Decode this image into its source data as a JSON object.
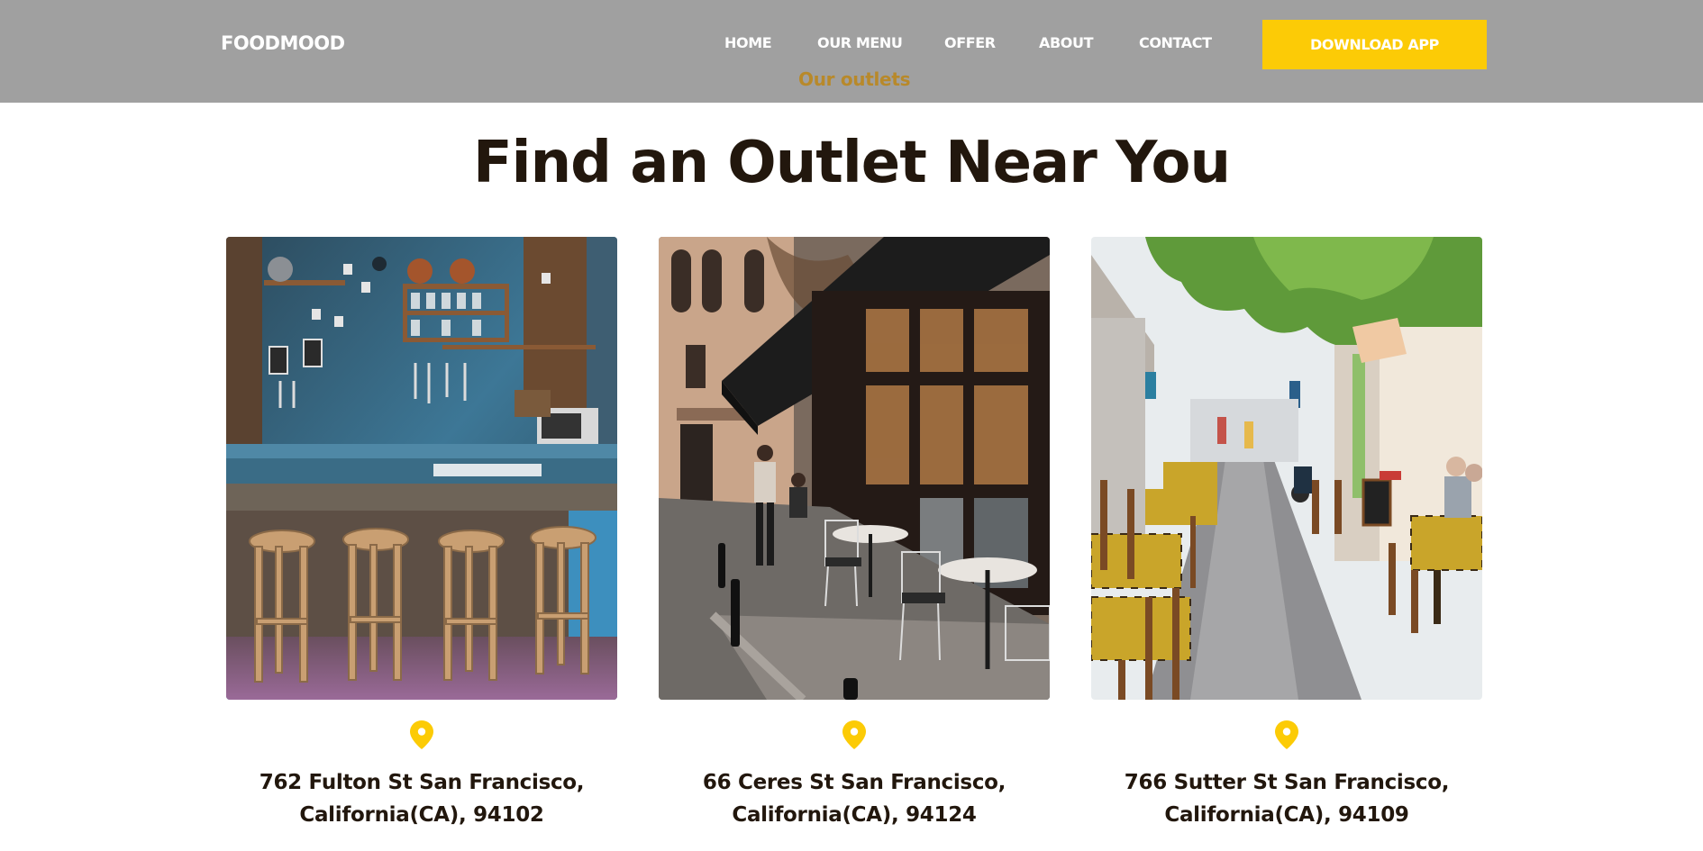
{
  "header": {
    "brand": "FOODMOOD",
    "nav": {
      "home": "HOME",
      "menu": "OUR MENU",
      "offer": "OFFER",
      "about": "ABOUT",
      "contact": "CONTACT",
      "outlets": "Our outlets"
    },
    "download_label": "DOWNLOAD APP"
  },
  "main": {
    "title": "Find an Outlet Near You",
    "outlets": [
      {
        "address_line1": "762 Fulton St San Francisco,",
        "address_line2": "California(CA), 94102",
        "icon": "location-pin-icon"
      },
      {
        "address_line1": "66 Ceres St San Francisco,",
        "address_line2": "California(CA), 94124",
        "icon": "location-pin-icon"
      },
      {
        "address_line1": "766 Sutter St San Francisco,",
        "address_line2": "California(CA), 94109",
        "icon": "location-pin-icon"
      }
    ]
  },
  "colors": {
    "header_bg": "#a0a0a0",
    "accent": "#fccb06",
    "outlets_link": "#b8892a",
    "text_dark": "#22170d"
  }
}
